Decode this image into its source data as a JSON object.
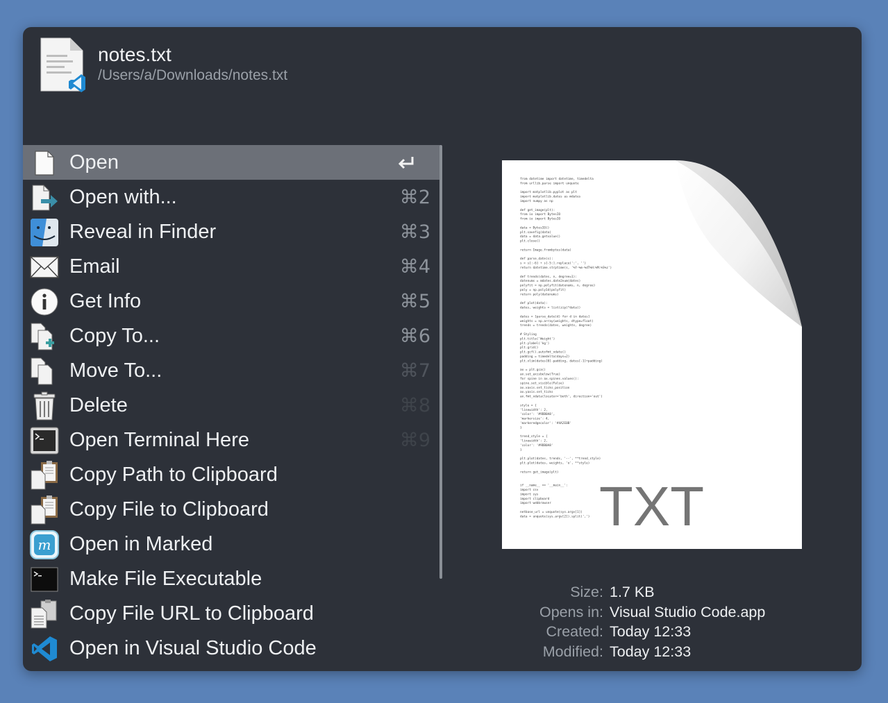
{
  "header": {
    "file_name": "notes.txt",
    "file_path": "/Users/a/Downloads/notes.txt"
  },
  "actions": [
    {
      "label": "Open",
      "shortcut": "",
      "icon": "document-icon",
      "selected": true
    },
    {
      "label": "Open with...",
      "shortcut": "⌘2",
      "icon": "open-with-icon"
    },
    {
      "label": "Reveal in Finder",
      "shortcut": "⌘3",
      "icon": "finder-icon"
    },
    {
      "label": "Email",
      "shortcut": "⌘4",
      "icon": "envelope-icon"
    },
    {
      "label": "Get Info",
      "shortcut": "⌘5",
      "icon": "info-icon"
    },
    {
      "label": "Copy To...",
      "shortcut": "⌘6",
      "icon": "copy-to-icon"
    },
    {
      "label": "Move To...",
      "shortcut": "⌘7",
      "icon": "move-to-icon"
    },
    {
      "label": "Delete",
      "shortcut": "⌘8",
      "icon": "trash-icon"
    },
    {
      "label": "Open Terminal Here",
      "shortcut": "⌘9",
      "icon": "terminal-window-icon"
    },
    {
      "label": "Copy Path to Clipboard",
      "shortcut": "",
      "icon": "clipboard-icon"
    },
    {
      "label": "Copy File to Clipboard",
      "shortcut": "",
      "icon": "clipboard-icon"
    },
    {
      "label": "Open in Marked",
      "shortcut": "",
      "icon": "marked-app-icon"
    },
    {
      "label": "Make File Executable",
      "shortcut": "",
      "icon": "terminal-icon"
    },
    {
      "label": "Copy File URL to Clipboard",
      "shortcut": "",
      "icon": "clipboard-url-icon"
    },
    {
      "label": "Open in Visual Studio Code",
      "shortcut": "",
      "icon": "vscode-icon"
    }
  ],
  "preview": {
    "badge": "TXT",
    "code_lines": [
      "from datetime import datetime, timedelta",
      "from urllib.parse import unquote",
      "",
      "import matplotlib.pyplot as plt",
      "import matplotlib.dates as mdates",
      "import numpy as np",
      "",
      "def get_image(plt):",
      "    from io import BytesIO",
      "    from io import BytesIO",
      "",
      "    data = BytesIO()",
      "    plt.savefig(data)",
      "    data = data.getvalue()",
      "    plt.close()",
      "",
      "    return Image.frombytes(data)",
      "",
      "def parse_date(s):",
      "    s = s[:-6] + s[-5:].replace(':', '')",
      "    return datetime.strptime(s, '%Y-%m-%dT%H:%M:%S%z')",
      "",
      "def trends(dates, n, degree=1):",
      "    datenums = mdates.date2num(dates)",
      "    polyfit = np.polyfit(datenums, n, degree)",
      "    poly = np.poly1d(polyfit)",
      "    return poly(datenums)",
      "",
      "def plot(data):",
      "    dates, weights = list(zip(*data))",
      "",
      "    dates = [parse_date(d) for d in dates]",
      "    weights = np.array(weights, dtype=float)",
      "    trends = trends(dates, weights, degree)",
      "",
      "    # Styling",
      "    plt.title('Weight')",
      "    plt.ylabel('kg')",
      "    plt.grid()",
      "    plt.gcf().autofmt_xdate()",
      "    padding = timedelta(days=2)",
      "    plt.xlim(dates[0]-padding, dates[-1]+padding)",
      "",
      "    ax = plt.gca()",
      "    ax.set_axisbelow(True)",
      "    for spine in ax.spines.values():",
      "        spine.set_visible(False)",
      "    ax.xaxis.set_ticks_position",
      "    ax.yaxis.set_ticks",
      "    ax.fmt_xdata(locator='both', direction='out')",
      "",
      "    style = {",
      "        'linewidth': 2,",
      "        'color': '#9DB0A8',",
      "        'markersize': 4,",
      "        'markeredgecolor': '#4A2E0B'",
      "    }",
      "",
      "    trend_style = {",
      "        'linewidth': 2,",
      "        'color': '#9DB0A8'",
      "    }",
      "",
      "    plt.plot(dates, trends, '--', **trend_style)",
      "    plt.plot(dates, weights, 'o', **style)",
      "",
      "    return get_image(plt)",
      "",
      "",
      "if __name__ == '__main__':",
      "    import csv",
      "    import sys",
      "    import clipboard",
      "    import webbrowser",
      "",
      "    netbase_url = unquote(sys.argv[1])",
      "    data = unquote(sys.argv[2]).split(',')"
    ]
  },
  "info": [
    {
      "key": "Size:",
      "value": "1.7 KB"
    },
    {
      "key": "Opens in:",
      "value": "Visual Studio Code.app"
    },
    {
      "key": "Created:",
      "value": "Today 12:33"
    },
    {
      "key": "Modified:",
      "value": "Today 12:33"
    }
  ],
  "colors": {
    "background": "#5a82b8",
    "panel": "#2d3139",
    "selection": "#6c7078",
    "vscode_blue": "#1f8ad2"
  }
}
